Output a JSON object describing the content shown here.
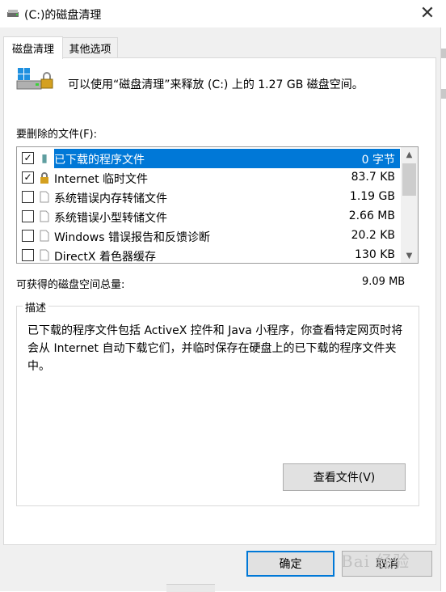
{
  "window": {
    "title": "(C:)的磁盘清理",
    "close_glyph": "✕"
  },
  "tabs": [
    {
      "label": "磁盘清理",
      "active": true
    },
    {
      "label": "其他选项",
      "active": false
    }
  ],
  "info": {
    "text": "可以使用“磁盘清理”来释放  (C:) 上的 1.27 GB 磁盘空间。"
  },
  "files": {
    "label": "要删除的文件(F):",
    "items": [
      {
        "name": "已下载的程序文件",
        "size": "0 字节",
        "checked": true,
        "selected": true,
        "icon": "folder-icon"
      },
      {
        "name": "Internet 临时文件",
        "size": "83.7 KB",
        "checked": true,
        "selected": false,
        "icon": "lock-icon"
      },
      {
        "name": "系统错误内存转储文件",
        "size": "1.19 GB",
        "checked": false,
        "selected": false,
        "icon": "file-icon"
      },
      {
        "name": "系统错误小型转储文件",
        "size": "2.66 MB",
        "checked": false,
        "selected": false,
        "icon": "file-icon"
      },
      {
        "name": "Windows 错误报告和反馈诊断",
        "size": "20.2 KB",
        "checked": false,
        "selected": false,
        "icon": "file-icon"
      },
      {
        "name": "DirectX 着色器缓存",
        "size": "130 KB",
        "checked": false,
        "selected": false,
        "icon": "file-icon"
      }
    ]
  },
  "total": {
    "label": "可获得的磁盘空间总量:",
    "value": "9.09 MB"
  },
  "description": {
    "legend": "描述",
    "text": "已下载的程序文件包括 ActiveX 控件和 Java 小程序，你查看特定网页时将会从 Internet 自动下载它们，并临时保存在硬盘上的已下载的程序文件夹中。"
  },
  "buttons": {
    "view_files": "查看文件(V)",
    "ok": "确定",
    "cancel": "取消"
  },
  "watermark": "Bai 经验",
  "colors": {
    "accent": "#0078d7",
    "dialog_bg": "#f0f0f0"
  }
}
